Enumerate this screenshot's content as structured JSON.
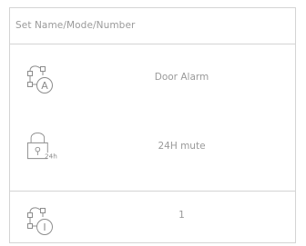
{
  "header": {
    "label": "Set Name/Mode/Number"
  },
  "rows": [
    {
      "label": "Door Alarm",
      "icon": "mode-a-icon",
      "badge": "A"
    },
    {
      "label": "24H mute",
      "icon": "lock-24h-icon",
      "badge": "24h"
    },
    {
      "label": "1",
      "icon": "number-icon",
      "badge": "I"
    }
  ],
  "colors": {
    "text": "#9a9a9a",
    "border": "#d4d4d4",
    "icon_stroke": "#8c8c8c"
  }
}
